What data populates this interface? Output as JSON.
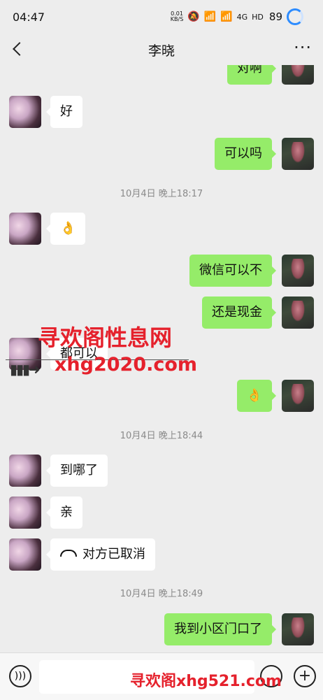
{
  "status_bar": {
    "time": "04:47",
    "net_speed_value": "0.01",
    "net_speed_unit": "KB/S",
    "signal": "4G",
    "hd": "HD",
    "battery": "89"
  },
  "header": {
    "title": "李晓",
    "more": "···"
  },
  "messages": [
    {
      "side": "out",
      "text": "对啊"
    },
    {
      "side": "in",
      "text": "好"
    },
    {
      "side": "out",
      "text": "可以吗"
    },
    {
      "type": "time",
      "text": "10月4日 晚上18:17"
    },
    {
      "side": "in",
      "text": "👌"
    },
    {
      "side": "out",
      "text": "微信可以不"
    },
    {
      "side": "out",
      "text": "还是现金"
    },
    {
      "side": "in",
      "text": "都可以"
    },
    {
      "side": "out",
      "text": "👌"
    },
    {
      "type": "time",
      "text": "10月4日 晚上18:44"
    },
    {
      "side": "in",
      "text": "到哪了"
    },
    {
      "side": "in",
      "text": "亲"
    },
    {
      "side": "in",
      "text": "对方已取消",
      "call": true
    },
    {
      "type": "time",
      "text": "10月4日 晚上18:49"
    },
    {
      "side": "out",
      "text": "我到小区门口了"
    }
  ],
  "watermarks": {
    "top_line1": "寻欢阁性息网",
    "top_line2": "xhg2020.com",
    "bottom": "寻欢阁xhg521.com"
  },
  "input": {
    "placeholder": ""
  },
  "colors": {
    "outgoing_bubble": "#95ec69",
    "incoming_bubble": "#ffffff",
    "background": "#ededed",
    "watermark": "#e5212c"
  }
}
